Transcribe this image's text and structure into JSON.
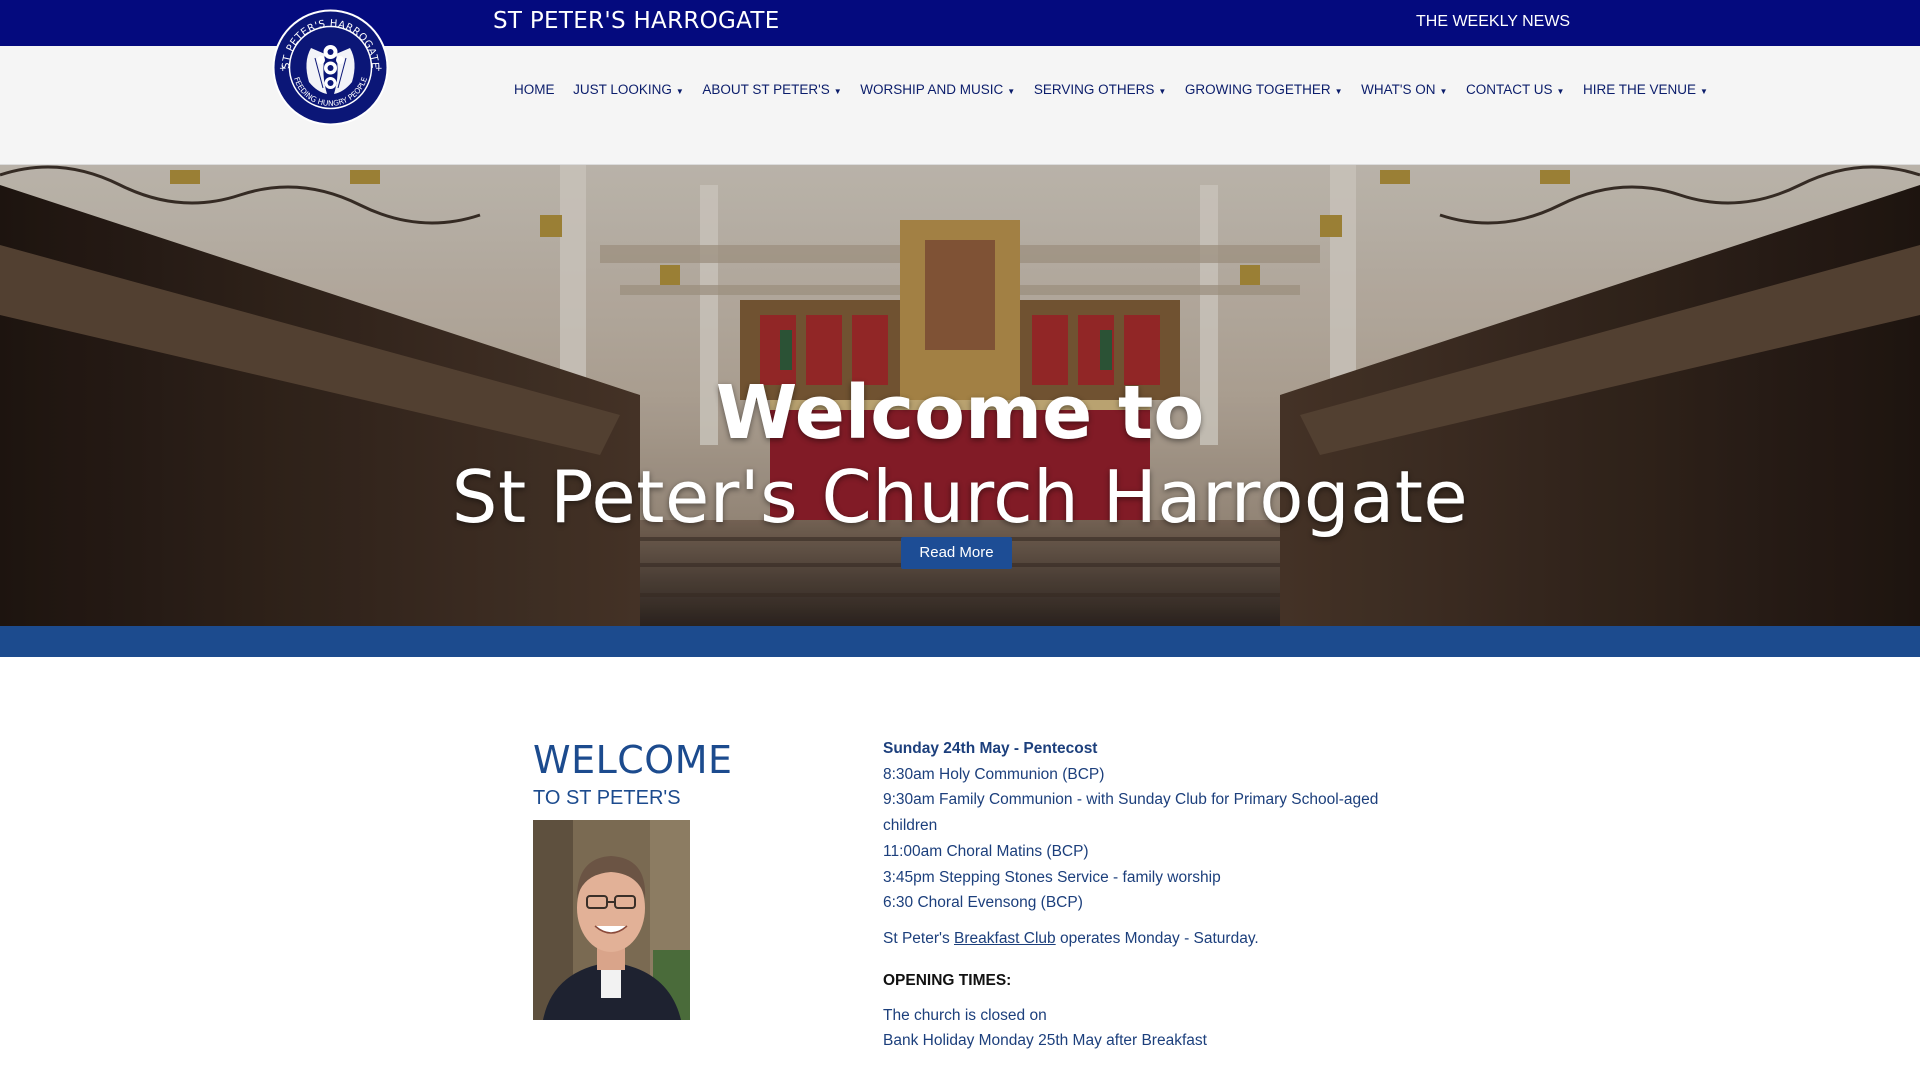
{
  "header": {
    "site_title": "ST PETER'S HARROGATE",
    "weekly_news": "THE WEEKLY NEWS",
    "logo_text": "ST PETER'S HARROGATE · FEEDING HUNGRY PEOPLE"
  },
  "nav": {
    "items": [
      {
        "label": "HOME",
        "dropdown": false
      },
      {
        "label": "JUST LOOKING",
        "dropdown": true
      },
      {
        "label": "ABOUT ST PETER'S",
        "dropdown": true
      },
      {
        "label": "WORSHIP AND MUSIC",
        "dropdown": true
      },
      {
        "label": "SERVING OTHERS",
        "dropdown": true
      },
      {
        "label": "GROWING TOGETHER",
        "dropdown": true
      },
      {
        "label": "WHAT'S ON",
        "dropdown": true
      },
      {
        "label": "CONTACT US",
        "dropdown": true
      },
      {
        "label": "HIRE THE VENUE",
        "dropdown": true
      }
    ],
    "caret": "▼"
  },
  "hero": {
    "title_line1": "Welcome to",
    "title_line2": "St Peter's Church Harrogate",
    "button": "Read More"
  },
  "welcome": {
    "heading": "WELCOME",
    "subheading": "TO ST PETER'S"
  },
  "services": {
    "date_heading": "Sunday 24th May - Pentecost",
    "lines": [
      "8:30am Holy Communion (BCP)",
      "9:30am Family Communion - with Sunday Club for Primary School-aged",
      "children",
      "11:00am Choral Matins (BCP)",
      "3:45pm Stepping Stones Service - family worship",
      "6:30 Choral Evensong (BCP)"
    ],
    "breakfast_prefix": "St Peter's ",
    "breakfast_link": "Breakfast Club",
    "breakfast_suffix": " operates Monday - Saturday.",
    "opening_heading": "OPENING TIMES:",
    "opening_lines": [
      "The church is closed on",
      "Bank Holiday Monday 25th May after Breakfast"
    ]
  },
  "colors": {
    "top_bar": "#040a7e",
    "accent_blue": "#1c4b8e",
    "nav_text": "#0b1d6b"
  }
}
